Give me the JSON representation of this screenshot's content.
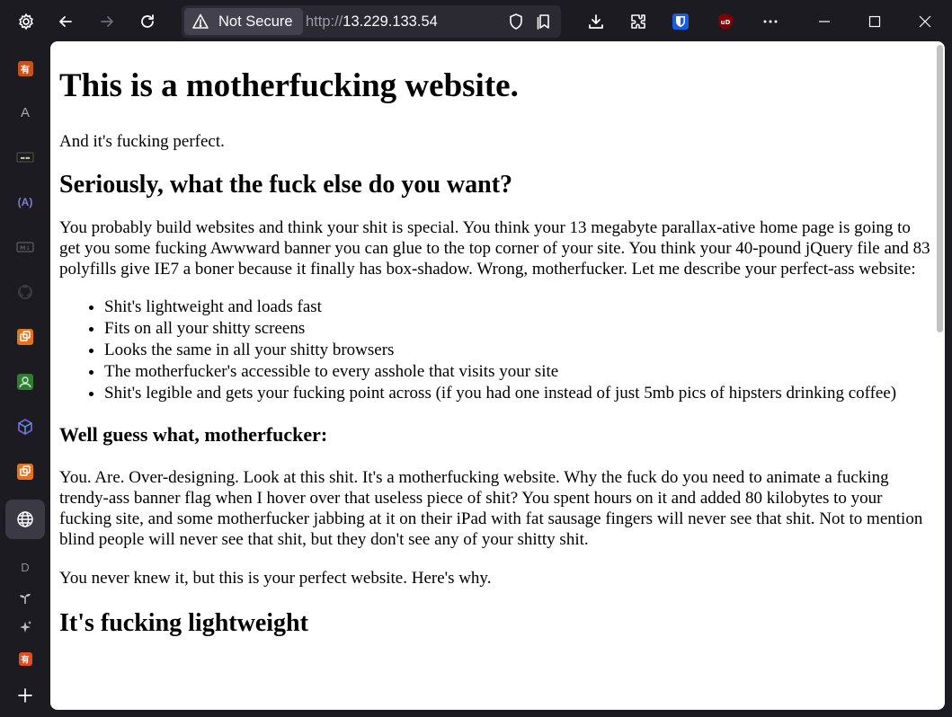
{
  "browser": {
    "security_label": "Not Secure",
    "url_scheme": "http://",
    "url_host": "13.229.133.54"
  },
  "sidebar": {
    "items": [
      {
        "name": "sidebar-item-app-1",
        "glyph": "有",
        "color": "#c8521e"
      },
      {
        "name": "sidebar-item-app-2",
        "glyph": "A",
        "color": ""
      },
      {
        "name": "sidebar-item-app-3",
        "glyph": "▬",
        "color": ""
      },
      {
        "name": "sidebar-item-app-4",
        "glyph": "(A)",
        "color": ""
      },
      {
        "name": "sidebar-item-app-5",
        "glyph": "M↓",
        "color": ""
      },
      {
        "name": "sidebar-item-github",
        "glyph": "",
        "color": ""
      },
      {
        "name": "sidebar-item-app-7",
        "glyph": "",
        "color": "#e6721a"
      },
      {
        "name": "sidebar-item-app-8",
        "glyph": "",
        "color": "#2e7d32"
      },
      {
        "name": "sidebar-item-app-9",
        "glyph": "",
        "color": "#7b5cd6"
      },
      {
        "name": "sidebar-item-app-10",
        "glyph": "",
        "color": "#e6721a"
      },
      {
        "name": "sidebar-item-web",
        "glyph": "",
        "color": ""
      },
      {
        "name": "sidebar-item-d",
        "glyph": "D",
        "color": ""
      },
      {
        "name": "sidebar-item-app-13",
        "glyph": "",
        "color": ""
      },
      {
        "name": "sidebar-item-app-14",
        "glyph": "",
        "color": ""
      },
      {
        "name": "sidebar-item-app-15",
        "glyph": "有",
        "color": "#e84b1c"
      }
    ]
  },
  "page": {
    "h1": "This is a motherfucking website.",
    "intro": "And it's fucking perfect.",
    "h2_1": "Seriously, what the fuck else do you want?",
    "p1": "You probably build websites and think your shit is special. You think your 13 megabyte parallax-ative home page is going to get you some fucking Awwward banner you can glue to the top corner of your site. You think your 40-pound jQuery file and 83 polyfills give IE7 a boner because it finally has box-shadow. Wrong, motherfucker. Let me describe your perfect-ass website:",
    "list": [
      "Shit's lightweight and loads fast",
      "Fits on all your shitty screens",
      "Looks the same in all your shitty browsers",
      "The motherfucker's accessible to every asshole that visits your site",
      "Shit's legible and gets your fucking point across (if you had one instead of just 5mb pics of hipsters drinking coffee)"
    ],
    "h3_1": "Well guess what, motherfucker:",
    "p2": "You. Are. Over-designing. Look at this shit. It's a motherfucking website. Why the fuck do you need to animate a fucking trendy-ass banner flag when I hover over that useless piece of shit? You spent hours on it and added 80 kilobytes to your fucking site, and some motherfucker jabbing at it on their iPad with fat sausage fingers will never see that shit. Not to mention blind people will never see that shit, but they don't see any of your shitty shit.",
    "p3": "You never knew it, but this is your perfect website. Here's why.",
    "h2_2": "It's fucking lightweight"
  }
}
